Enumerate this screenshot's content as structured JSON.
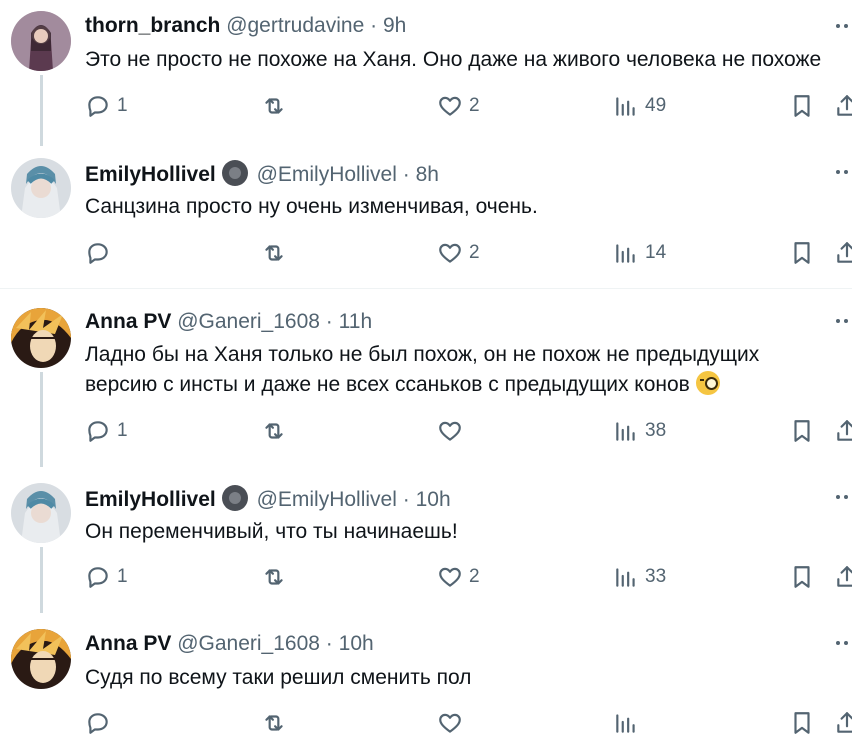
{
  "tweets": [
    {
      "name": "thorn_branch",
      "handle": "@gertrudavine",
      "separator": "·",
      "time": "9h",
      "verified": false,
      "text_lines": [
        "Это не просто не похоже на Ханя. Оно даже на живого человека не похоже"
      ],
      "replies": "1",
      "retweets": "",
      "likes": "2",
      "views": "49"
    },
    {
      "name": "EmilyHollivel",
      "handle": "@EmilyHollivel",
      "separator": "·",
      "time": "8h",
      "verified": true,
      "text_lines": [
        "Санцзина просто ну очень изменчивая, очень."
      ],
      "replies": "",
      "retweets": "",
      "likes": "2",
      "views": "14"
    },
    {
      "name": "Anna PV",
      "handle": "@Ganeri_1608",
      "separator": "·",
      "time": "11h",
      "verified": false,
      "text_lines": [
        "Ладно бы на Ханя только не был похож, он не похож не предыдущих",
        "версию с инсты и даже не всех ссаньков с предыдущих конов"
      ],
      "emoji": "face-with-monocle",
      "replies": "1",
      "retweets": "",
      "likes": "",
      "views": "38"
    },
    {
      "name": "EmilyHollivel",
      "handle": "@EmilyHollivel",
      "separator": "·",
      "time": "10h",
      "verified": true,
      "text_lines": [
        "Он переменчивый, что ты начинаешь!"
      ],
      "replies": "1",
      "retweets": "",
      "likes": "2",
      "views": "33"
    },
    {
      "name": "Anna PV",
      "handle": "@Ganeri_1608",
      "separator": "·",
      "time": "10h",
      "verified": false,
      "text_lines": [
        "Судя по всему таки решил сменить пол"
      ],
      "replies": "",
      "retweets": "",
      "likes": "",
      "views": ""
    }
  ],
  "icons": {
    "reply": "reply-icon",
    "retweet": "retweet-icon",
    "like": "like-icon",
    "views": "views-icon",
    "bookmark": "bookmark-icon",
    "share": "share-icon",
    "more": "more-icon"
  },
  "colors": {
    "text": "#0f1419",
    "secondary": "#536471",
    "thread_line": "#cfd9de",
    "divider": "#eff3f4",
    "background": "#ffffff"
  }
}
